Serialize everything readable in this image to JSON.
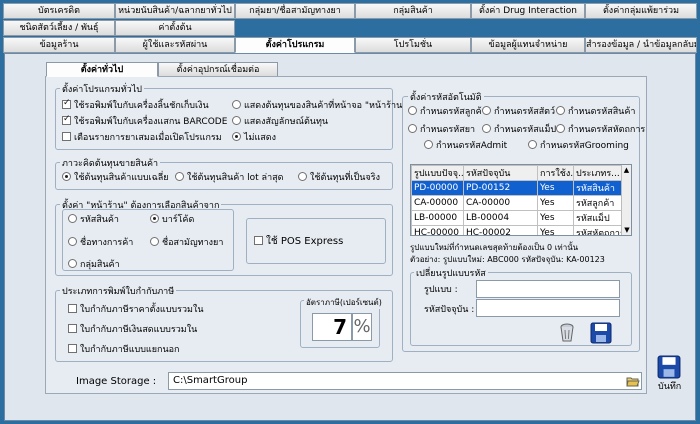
{
  "menu": {
    "row1": [
      "บัตรเครดิต",
      "หน่วยนับสินค้า/ฉลากยาทั่วไป",
      "กลุ่มยา/ชื่อสามัญทางยา",
      "กลุ่มสินค้า",
      "ตั้งค่า Drug Interaction",
      "ตั้งค่ากลุ่มแพ้ยาร่วม"
    ],
    "row2": [
      "ชนิดสัตว์เลี้ยง / พันธุ์",
      "ค่าตั้งต้น"
    ],
    "row3": [
      "ข้อมูลร้าน",
      "ผู้ใช้และรหัสผ่าน",
      "ตั้งค่าโปรแกรม",
      "โปรโมชั่น",
      "ข้อมูลผู้แทนจำหน่าย",
      "สำรองข้อมูล / นำข้อมูลกลับมา"
    ]
  },
  "subtabs": [
    "ตั้งค่าทั่วไป",
    "ตั้งค่าอุปกรณ์เชื่อมต่อ"
  ],
  "general": {
    "title": "ตั้งค่าโปรแกรมทั่วไป",
    "left_options": [
      {
        "label": "ใช้รอพิมพ์ใบกับเครื่องลิ้นชักเก็บเงิน",
        "checked": true
      },
      {
        "label": "ใช้รอพิมพ์ใบกับเครื่องแสกน BARCODE",
        "checked": true
      },
      {
        "label": "เตือนรายการยาเสมอเมื่อเปิดโปรแกรม",
        "checked": false
      }
    ],
    "right_options": [
      {
        "label": "แสดงต้นทุนของสินค้าที่หน้าจอ \"หน้าร้าน\"",
        "checked": false
      },
      {
        "label": "แสดงสัญลักษณ์ต้นทุน",
        "checked": false
      },
      {
        "label": "ไม่แสดง",
        "checked": true
      }
    ]
  },
  "cost": {
    "title": "ภาวะคิดต้นทุนขายสินค้า",
    "options": [
      {
        "label": "ใช้ต้นทุนสินค้าแบบเฉลี่ย",
        "checked": true
      },
      {
        "label": "ใช้ต้นทุนสินค้า lot ล่าสุด",
        "checked": false
      },
      {
        "label": "ใช้ต้นทุนที่เป็นจริง",
        "checked": false
      }
    ]
  },
  "storefront": {
    "title": "ตั้งค่า \"หน้าร้าน\" ต้องการเลือกสินค้าจาก",
    "options": [
      {
        "label": "รหัสสินค้า",
        "checked": false
      },
      {
        "label": "บาร์โค้ด",
        "checked": true
      },
      {
        "label": "ชื่อทางการค้า",
        "checked": false
      },
      {
        "label": "ชื่อสามัญทางยา",
        "checked": false
      },
      {
        "label": "กลุ่มสินค้า",
        "checked": false
      }
    ],
    "pos_express": {
      "label": "ใช้ POS Express",
      "checked": false
    }
  },
  "print": {
    "title": "ประเภทการพิมพ์ใบกำกับภาษี",
    "options": [
      {
        "label": "ใบกำกับภาษีราคาตั้งแบบรวมใน",
        "checked": false
      },
      {
        "label": "ใบกำกับภาษีเงินสดแบบรวมใน",
        "checked": false
      },
      {
        "label": "ใบกำกับภาษีแบบแยกนอก",
        "checked": false
      }
    ],
    "vat_title": "อัตราภาษี(เปอร์เซนต์)",
    "vat_value": "7",
    "vat_unit": "%"
  },
  "codes": {
    "title": "ตั้งค่ารหัสอัตโนมัติ",
    "options": [
      {
        "label": "กำหนดรหัสลูกค้า",
        "checked": false
      },
      {
        "label": "กำหนดรหัสสัตว์",
        "checked": false
      },
      {
        "label": "กำหนดรหัสสินค้า",
        "checked": false
      },
      {
        "label": "กำหนดรหัสยา",
        "checked": false
      },
      {
        "label": "กำหนดรหัสแม็ป",
        "checked": false
      },
      {
        "label": "กำหนดรหัสหัตถการ",
        "checked": false
      },
      {
        "label": "กำหนดรหัสAdmit",
        "checked": false
      },
      {
        "label": "กำหนดรหัสGrooming",
        "checked": false
      }
    ],
    "table": {
      "headers": [
        "รูปแบบปัจจุ...",
        "รหัสปัจจุบัน",
        "การใช้ง...",
        "ประเภทร..."
      ],
      "rows": [
        [
          "PD-00000",
          "PD-00152",
          "Yes",
          "รหัสสินค้า"
        ],
        [
          "CA-00000",
          "CA-00000",
          "Yes",
          "รหัสลูกค้า"
        ],
        [
          "LB-00000",
          "LB-00004",
          "Yes",
          "รหัสแม็ป"
        ],
        [
          "HC-00000",
          "HC-00002",
          "Yes",
          "รหัสหัตถการ"
        ]
      ],
      "selected": 0
    },
    "note1": "รูปแบบใหม่ที่กำหนดเลขสุดท้ายต้องเป็น 0 เท่านั้น",
    "note2": "ตัวอย่าง: รูปแบบใหม่: ABC000 รหัสปัจจุบัน: KA-00123",
    "change_title": "เปลี่ยนรูปแบบรหัส",
    "format_label": "รูปแบบ :",
    "current_label": "รหัสปัจจุบัน :",
    "format_value": "",
    "current_value": ""
  },
  "storage": {
    "label": "Image Storage :",
    "value": "C:\\SmartGroup"
  },
  "save_label": "บันทึก"
}
